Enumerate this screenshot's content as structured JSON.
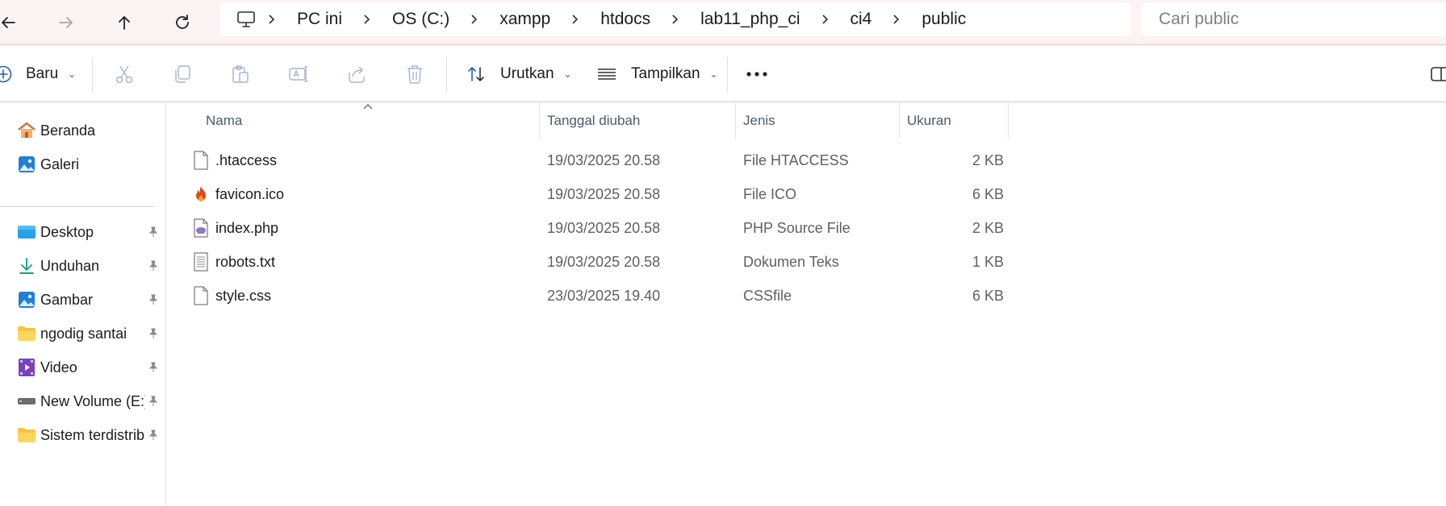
{
  "breadcrumb": {
    "items": [
      "PC ini",
      "OS (C:)",
      "xampp",
      "htdocs",
      "lab11_php_ci",
      "ci4",
      "public"
    ]
  },
  "search": {
    "placeholder": "Cari public"
  },
  "commandbar": {
    "new_label": "Baru",
    "sort_label": "Urutkan",
    "view_label": "Tampilkan"
  },
  "sidebar": {
    "top_items": [
      {
        "label": "Beranda",
        "icon": "home-icon"
      },
      {
        "label": "Galeri",
        "icon": "gallery-icon"
      }
    ],
    "pinned_items": [
      {
        "label": "Desktop",
        "icon": "desktop-folder-icon"
      },
      {
        "label": "Unduhan",
        "icon": "download-icon"
      },
      {
        "label": "Gambar",
        "icon": "pictures-icon"
      },
      {
        "label": "ngodig santai",
        "icon": "folder-icon"
      },
      {
        "label": "Video",
        "icon": "video-icon"
      },
      {
        "label": "New Volume (E:)",
        "icon": "drive-icon"
      },
      {
        "label": "Sistem terdistrib",
        "icon": "folder-icon"
      }
    ]
  },
  "filelist": {
    "columns": {
      "name": "Nama",
      "date": "Tanggal diubah",
      "type": "Jenis",
      "size": "Ukuran"
    },
    "rows": [
      {
        "name": ".htaccess",
        "date": "19/03/2025 20.58",
        "type": "File HTACCESS",
        "size": "2 KB",
        "icon": "blank-file-icon"
      },
      {
        "name": "favicon.ico",
        "date": "19/03/2025 20.58",
        "type": "File ICO",
        "size": "6 KB",
        "icon": "flame-icon"
      },
      {
        "name": "index.php",
        "date": "19/03/2025 20.58",
        "type": "PHP Source File",
        "size": "2 KB",
        "icon": "php-file-icon"
      },
      {
        "name": "robots.txt",
        "date": "19/03/2025 20.58",
        "type": "Dokumen Teks",
        "size": "1 KB",
        "icon": "text-file-icon"
      },
      {
        "name": "style.css",
        "date": "23/03/2025 19.40",
        "type": "CSSfile",
        "size": "6 KB",
        "icon": "blank-file-icon"
      }
    ]
  }
}
